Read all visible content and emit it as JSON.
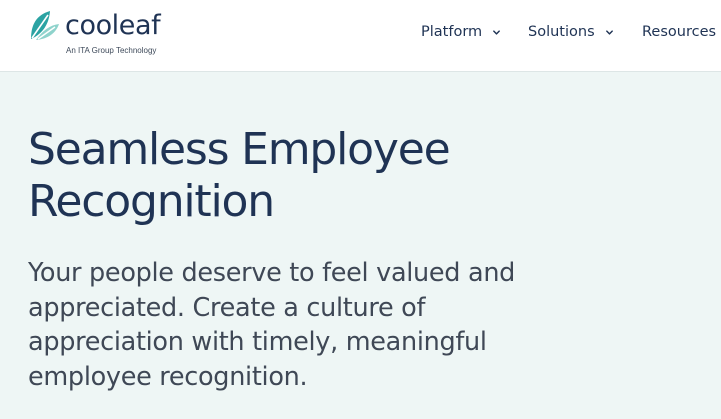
{
  "header": {
    "logo": {
      "name": "cooleaf",
      "tagline": "An ITA Group Technology",
      "mark_icon": "leaf-logo-icon"
    },
    "nav": [
      {
        "label": "Platform",
        "icon": "chevron-down-icon"
      },
      {
        "label": "Solutions",
        "icon": "chevron-down-icon"
      },
      {
        "label": "Resources"
      }
    ]
  },
  "hero": {
    "title": "Seamless Employee Recognition",
    "subtitle": "Your people deserve to feel valued and appreciated. Create a culture of appreciation with timely, meaningful employee recognition."
  },
  "colors": {
    "header_bg": "#ffffff",
    "page_bg": "#eef6f5",
    "brand_navy": "#1f3354",
    "body_text": "#3f4856",
    "leaf_teal": "#2ba3a3",
    "leaf_light": "#8fd3cc"
  }
}
